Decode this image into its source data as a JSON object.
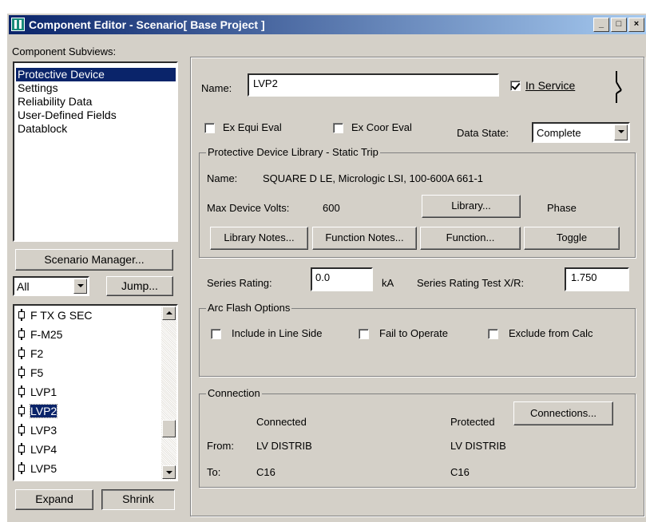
{
  "window": {
    "title": "Component Editor  - Scenario[ Base Project ]",
    "minimize": "_",
    "maximize": "□",
    "close": "×"
  },
  "subviews": {
    "label": "Component Subviews:",
    "items": [
      "Protective Device",
      "Settings",
      "Reliability Data",
      "User-Defined Fields",
      "Datablock"
    ],
    "selected": 0
  },
  "scenario_manager": "Scenario Manager...",
  "filter": {
    "value": "All",
    "jump": "Jump..."
  },
  "tree": {
    "items": [
      "F TX G SEC",
      "F-M25",
      "F2",
      "F5",
      "LVP1",
      "LVP2",
      "LVP3",
      "LVP4",
      "LVP5"
    ],
    "selected": "LVP2"
  },
  "expand": "Expand",
  "shrink": "Shrink",
  "form": {
    "name_label": "Name:",
    "name_value": "LVP2",
    "in_service": "In Service",
    "in_service_checked": true,
    "ex_equi": "Ex Equi Eval",
    "ex_coor": "Ex Coor Eval",
    "data_state_label": "Data State:",
    "data_state_value": "Complete"
  },
  "library": {
    "group": "Protective Device Library - Static Trip",
    "name_label": "Name:",
    "name_value": "SQUARE D  LE, Micrologic  LSI, 100-600A  661-1",
    "max_volts_label": "Max Device Volts:",
    "max_volts_value": "600",
    "library_btn": "Library...",
    "phase": "Phase",
    "library_notes_btn": "Library Notes...",
    "function_notes_btn": "Function Notes...",
    "function_btn": "Function...",
    "toggle_btn": "Toggle"
  },
  "series": {
    "label": "Series Rating:",
    "value": "0.0",
    "unit": "kA",
    "xr_label": "Series Rating Test X/R:",
    "xr_value": "1.750"
  },
  "arc": {
    "group": "Arc Flash Options",
    "include": "Include in Line Side",
    "fail": "Fail to Operate",
    "exclude": "Exclude from Calc"
  },
  "connection": {
    "group": "Connection",
    "connected": "Connected",
    "protected": "Protected",
    "connections_btn": "Connections...",
    "from_label": "From:",
    "from_value": "LV DISTRIB",
    "from_protected": "LV DISTRIB",
    "to_label": "To:",
    "to_value": "C16",
    "to_protected": "C16"
  },
  "colors": {
    "title_start": "#0a246a",
    "title_end": "#a6caf0",
    "selection": "#0a246a",
    "face": "#d4d0c8"
  }
}
